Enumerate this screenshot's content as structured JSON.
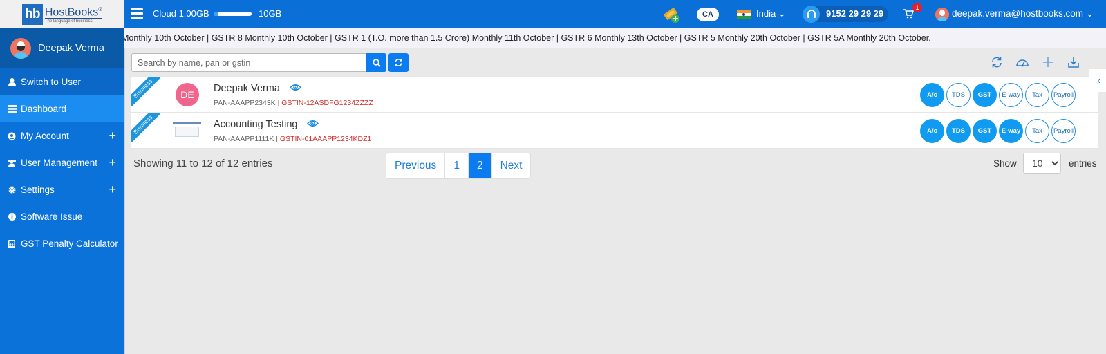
{
  "brand": {
    "logo_mark": "hb",
    "name": "HostBooks",
    "registered": "®",
    "tagline": "The language of business"
  },
  "topbar": {
    "menu_icon": "hamburger-icon",
    "cloud_label": "Cloud 1.00GB",
    "cloud_usage_percent": 10,
    "cloud_max": "10GB",
    "ticket_icon": "ticket-add-icon",
    "ca_label": "CA",
    "country": "India",
    "phone": "9152 29 29 29",
    "cart_count": "1",
    "user_email": "deepak.verma@hostbooks.com",
    "colors": {
      "bar": "#0a6fd6",
      "badge": "#e5202a"
    }
  },
  "sidebar": {
    "profile_name": "Deepak Verma",
    "items": [
      {
        "label": "Switch to User",
        "icon": "user-icon",
        "expandable": false
      },
      {
        "label": "Dashboard",
        "icon": "dashboard-icon",
        "expandable": false,
        "active": true
      },
      {
        "label": "My Account",
        "icon": "account-circle-icon",
        "expandable": true
      },
      {
        "label": "User Management",
        "icon": "users-icon",
        "expandable": true
      },
      {
        "label": "Settings",
        "icon": "gear-icon",
        "expandable": true
      },
      {
        "label": "Software Issue",
        "icon": "info-icon",
        "expandable": false
      },
      {
        "label": "GST Penalty Calculator",
        "icon": "calculator-icon",
        "expandable": false
      }
    ],
    "expand_symbol": "+"
  },
  "ticker": {
    "text": "Monthly 10th October | GSTR 8 Monthly 10th October | GSTR 1 (T.O. more than 1.5 Crore) Monthly 11th October | GSTR 6 Monthly 13th October | GSTR 5 Monthly 20th October | GSTR 5A Monthly 20th October."
  },
  "search": {
    "placeholder": "Search by name, pan or gstin",
    "value": ""
  },
  "toolbar": {
    "icons": [
      "refresh-icon",
      "dashboard-gauge-icon",
      "add-icon",
      "download-icon"
    ]
  },
  "collapse_symbol": "«",
  "rows": [
    {
      "ribbon": "Business",
      "avatar_initials": "DE",
      "name": "Deepak Verma",
      "pan": "PAN-AAAPP2343K",
      "separator": " | ",
      "gstin": "GSTIN-12ASDFG1234ZZZZ",
      "modules": [
        {
          "label": "A/c",
          "enabled": true
        },
        {
          "label": "TDS",
          "enabled": false
        },
        {
          "label": "GST",
          "enabled": true
        },
        {
          "label": "E-way",
          "enabled": false
        },
        {
          "label": "Tax",
          "enabled": false
        },
        {
          "label": "Payroll",
          "enabled": false
        }
      ]
    },
    {
      "ribbon": "Business",
      "avatar_initials": "",
      "name": "Accounting Testing",
      "pan": "PAN-AAAPP1111K",
      "separator": " | ",
      "gstin": "GSTIN-01AAAPP1234KDZ1",
      "modules": [
        {
          "label": "A/c",
          "enabled": true
        },
        {
          "label": "TDS",
          "enabled": true
        },
        {
          "label": "GST",
          "enabled": true
        },
        {
          "label": "E-way",
          "enabled": true
        },
        {
          "label": "Tax",
          "enabled": false
        },
        {
          "label": "Payroll",
          "enabled": false
        }
      ]
    }
  ],
  "pagination": {
    "showing": "Showing 11 to 12 of 12 entries",
    "previous": "Previous",
    "pages": [
      "1",
      "2"
    ],
    "current_page": "2",
    "next": "Next"
  },
  "page_size": {
    "show_label": "Show",
    "value": "10",
    "entries_label": "entries"
  }
}
